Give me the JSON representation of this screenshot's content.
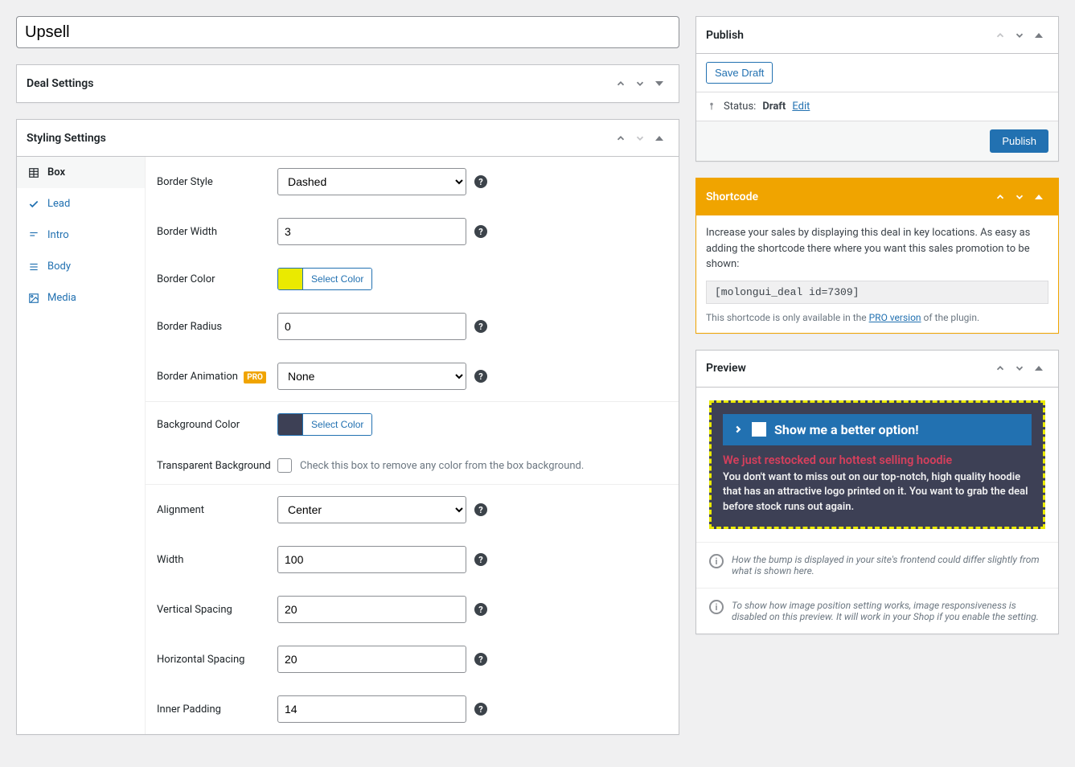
{
  "title": "Upsell",
  "deal_settings": {
    "title": "Deal Settings"
  },
  "styling": {
    "title": "Styling Settings",
    "tabs": [
      {
        "label": "Box"
      },
      {
        "label": "Lead"
      },
      {
        "label": "Intro"
      },
      {
        "label": "Body"
      },
      {
        "label": "Media"
      }
    ],
    "fields": {
      "border_style": {
        "label": "Border Style",
        "value": "Dashed"
      },
      "border_width": {
        "label": "Border Width",
        "value": "3"
      },
      "border_color": {
        "label": "Border Color",
        "btn": "Select Color",
        "swatch": "#eaea00"
      },
      "border_radius": {
        "label": "Border Radius",
        "value": "0"
      },
      "border_animation": {
        "label": "Border Animation",
        "badge": "PRO",
        "value": "None"
      },
      "bg_color": {
        "label": "Background Color",
        "btn": "Select Color",
        "swatch": "#3d4055"
      },
      "transparent_bg": {
        "label": "Transparent Background",
        "hint": "Check this box to remove any color from the box background."
      },
      "alignment": {
        "label": "Alignment",
        "value": "Center"
      },
      "width": {
        "label": "Width",
        "value": "100"
      },
      "vspacing": {
        "label": "Vertical Spacing",
        "value": "20"
      },
      "hspacing": {
        "label": "Horizontal Spacing",
        "value": "20"
      },
      "inner_padding": {
        "label": "Inner Padding",
        "value": "14"
      }
    }
  },
  "publish": {
    "title": "Publish",
    "save_draft": "Save Draft",
    "status_label": "Status:",
    "status_value": "Draft",
    "edit": "Edit",
    "publish_btn": "Publish"
  },
  "shortcode": {
    "title": "Shortcode",
    "desc": "Increase your sales by displaying this deal in key locations. As easy as adding the shortcode there where you want this sales promotion to be shown:",
    "code": "[molongui_deal id=7309]",
    "note_pre": "This shortcode is only available in the ",
    "note_link": "PRO version",
    "note_post": " of the plugin."
  },
  "preview": {
    "title": "Preview",
    "lead": "Show me a better option!",
    "intro": "We just restocked our hottest selling hoodie",
    "body": "You don't want to miss out on our top-notch, high quality hoodie that has an attractive logo printed on it. You want to grab the deal before stock runs out again.",
    "note1": "How the bump is displayed in your site's frontend could differ slightly from what is shown here.",
    "note2": "To show how image position setting works, image responsiveness is disabled on this preview. It will work in your Shop if you enable the setting."
  }
}
